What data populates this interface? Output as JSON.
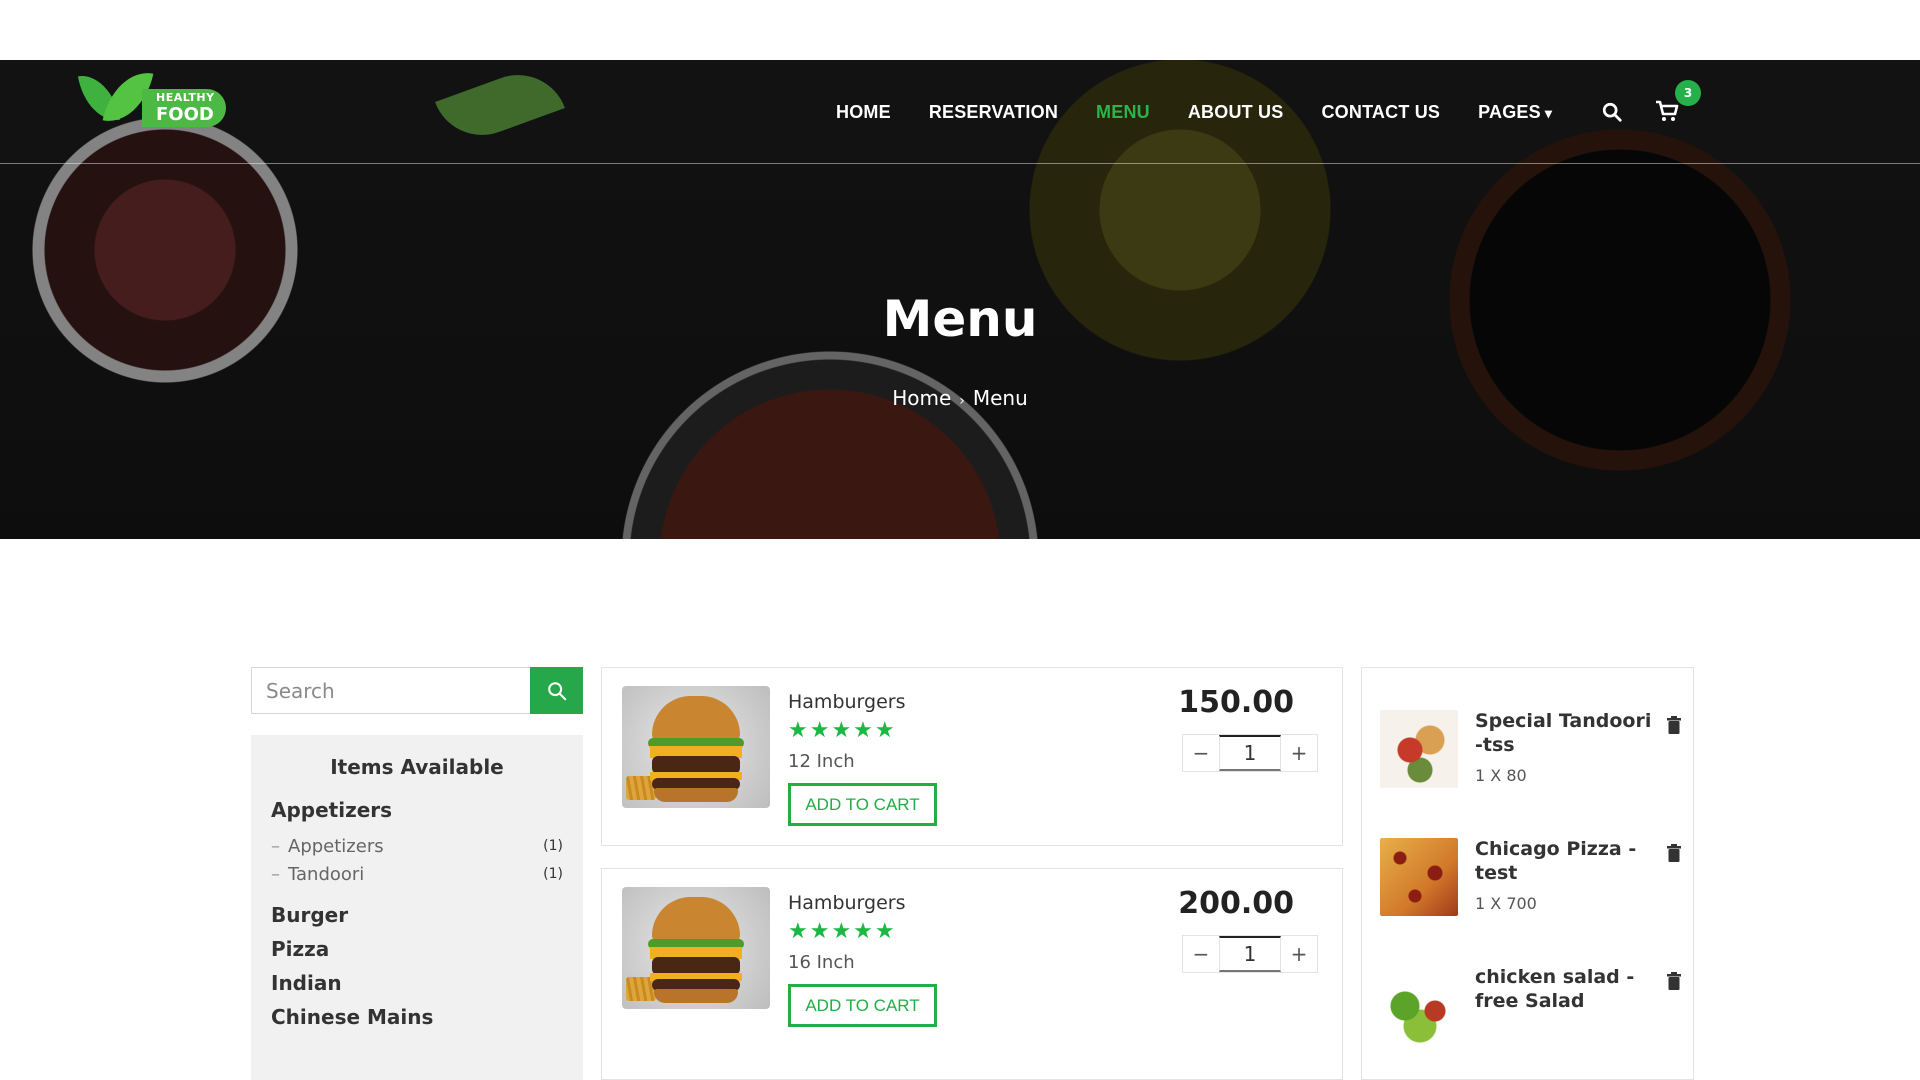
{
  "brand": {
    "logo_top": "HEALTHY",
    "logo_bottom": "FOOD"
  },
  "nav": {
    "items": [
      {
        "label": "HOME",
        "active": false
      },
      {
        "label": "RESERVATION",
        "active": false
      },
      {
        "label": "MENU",
        "active": true
      },
      {
        "label": "ABOUT US",
        "active": false
      },
      {
        "label": "CONTACT US",
        "active": false
      },
      {
        "label": "PAGES",
        "active": false
      }
    ],
    "search_icon": "search-icon",
    "cart_icon": "cart-icon",
    "cart_count": "3"
  },
  "hero": {
    "title": "Menu",
    "breadcrumb": {
      "home": "Home",
      "separator": "›",
      "current": "Menu"
    }
  },
  "sidebar": {
    "search": {
      "placeholder": "Search",
      "value": ""
    },
    "panel_title": "Items Available",
    "categories": [
      {
        "label": "Appetizers",
        "sub": [
          {
            "label": "Appetizers",
            "count": "(1)"
          },
          {
            "label": "Tandoori",
            "count": "(1)"
          }
        ]
      },
      {
        "label": "Burger"
      },
      {
        "label": "Pizza"
      },
      {
        "label": "Indian"
      },
      {
        "label": "Chinese Mains"
      }
    ]
  },
  "products": [
    {
      "name": "Hamburgers",
      "rating": 5,
      "stars": "★★★★★",
      "size": "12 Inch",
      "price": "150.00",
      "qty": "1",
      "add_label": "ADD TO CART"
    },
    {
      "name": "Hamburgers",
      "rating": 5,
      "stars": "★★★★★",
      "size": "16 Inch",
      "price": "200.00",
      "qty": "1",
      "add_label": "ADD TO CART"
    }
  ],
  "cart": {
    "items": [
      {
        "name": "Special Tandoori -tss",
        "qty_line": "1 X 80"
      },
      {
        "name": "Chicago Pizza - test",
        "qty_line": "1 X 700"
      },
      {
        "name": "chicken salad - free Salad",
        "qty_line": ""
      }
    ]
  },
  "colors": {
    "accent": "#2db34a",
    "badge": "#25b04a",
    "button_border": "#22ad46"
  },
  "qty_controls": {
    "minus": "−",
    "plus": "+"
  }
}
